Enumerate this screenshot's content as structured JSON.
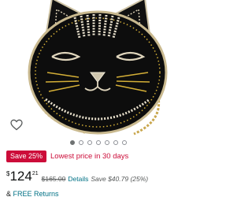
{
  "product": {
    "image_alt": "Black beaded cat face crossbody bag with gold chain strap"
  },
  "gallery": {
    "dot_count": 7,
    "active_index": 0
  },
  "wishlist": {
    "icon": "heart-outline-icon"
  },
  "deal": {
    "badge": "Save 25%",
    "text": "Lowest price in 30 days",
    "badge_color": "#cc0c39",
    "text_color": "#cc0c39"
  },
  "price": {
    "currency": "$",
    "whole": "124",
    "fraction": "21",
    "list_price": "$165.00",
    "details_label": "Details",
    "savings": "Save $40.79 (25%)"
  },
  "returns": {
    "prefix": "& ",
    "link": "FREE Returns"
  },
  "colors": {
    "link": "#007185",
    "muted": "#565959"
  }
}
